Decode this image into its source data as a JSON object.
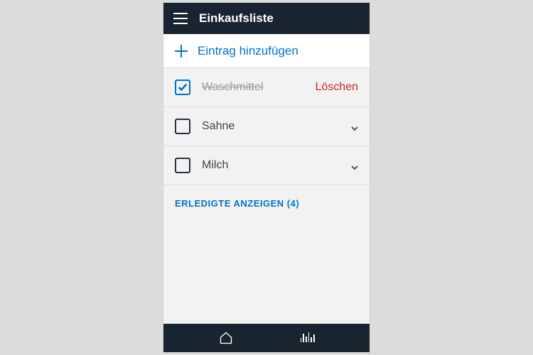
{
  "header": {
    "title": "Einkaufsliste"
  },
  "add": {
    "label": "Eintrag hinzufügen"
  },
  "items": [
    {
      "label": "Waschmittel",
      "checked": true,
      "action": "Löschen"
    },
    {
      "label": "Sahne",
      "checked": false
    },
    {
      "label": "Milch",
      "checked": false
    }
  ],
  "completed": {
    "label": "ERLEDIGTE ANZEIGEN (4)",
    "count": 4
  },
  "colors": {
    "accent": "#0073c6",
    "danger": "#c62828",
    "header_bg": "#1a2430"
  }
}
